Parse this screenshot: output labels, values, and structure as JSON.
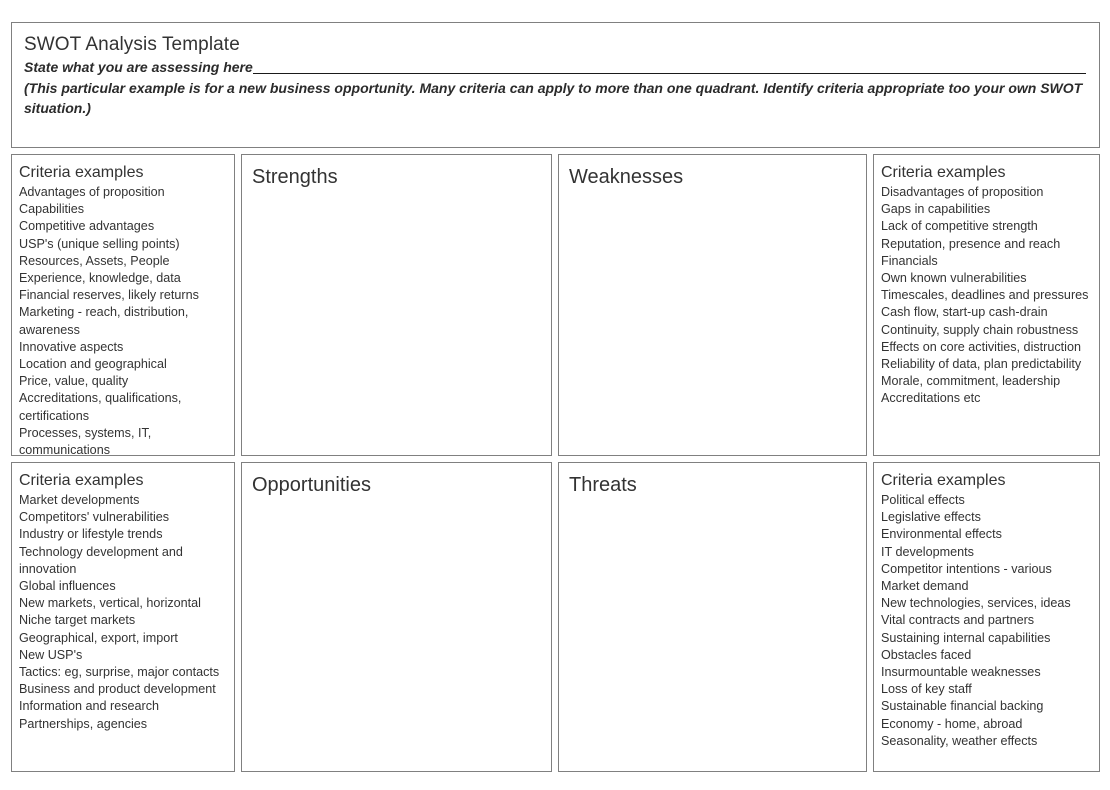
{
  "header": {
    "title": "SWOT Analysis Template",
    "subtitle": "State what you are assessing here",
    "note": "(This particular example is for a new business opportunity. Many criteria can apply to more than one quadrant. Identify criteria appropriate too your own SWOT situation.)"
  },
  "criteria_heading": "Criteria examples",
  "quadrants": {
    "strengths": {
      "label": "Strengths"
    },
    "weaknesses": {
      "label": "Weaknesses"
    },
    "opportunities": {
      "label": "Opportunities"
    },
    "threats": {
      "label": "Threats"
    }
  },
  "criteria": {
    "strengths": [
      "Advantages of proposition",
      "Capabilities",
      "Competitive advantages",
      "USP's (unique selling points)",
      "Resources, Assets, People",
      "Experience, knowledge, data",
      "Financial reserves, likely returns",
      "Marketing -  reach, distribution, awareness",
      "Innovative aspects",
      "Location and geographical",
      "Price, value, quality",
      "Accreditations, qualifications, certifications",
      "Processes, systems, IT, communications"
    ],
    "weaknesses": [
      "Disadvantages of proposition",
      "Gaps in capabilities",
      "Lack of competitive strength",
      "Reputation, presence and reach",
      "Financials",
      "Own known vulnerabilities",
      "Timescales, deadlines and pressures",
      "Cash flow, start-up cash-drain",
      "Continuity, supply chain robustness",
      "Effects on core activities, distruction",
      "Reliability of data, plan predictability",
      "Morale, commitment, leadership",
      "Accreditations etc"
    ],
    "opportunities": [
      "Market developments",
      "Competitors' vulnerabilities",
      "Industry or lifestyle trends",
      "Technology development and innovation",
      "Global influences",
      "New markets, vertical, horizontal",
      "Niche target markets",
      "Geographical, export, import",
      "New USP's",
      "Tactics: eg, surprise, major contacts",
      "Business and product development",
      "Information and research",
      "Partnerships, agencies"
    ],
    "threats": [
      "Political effects",
      "Legislative effects",
      "Environmental effects",
      "IT developments",
      "Competitor intentions - various",
      "Market demand",
      "New technologies, services, ideas",
      "Vital contracts and partners",
      "Sustaining internal capabilities",
      "Obstacles faced",
      "Insurmountable weaknesses",
      "Loss of key staff",
      "Sustainable financial backing",
      "Economy - home, abroad",
      "Seasonality, weather effects"
    ]
  }
}
